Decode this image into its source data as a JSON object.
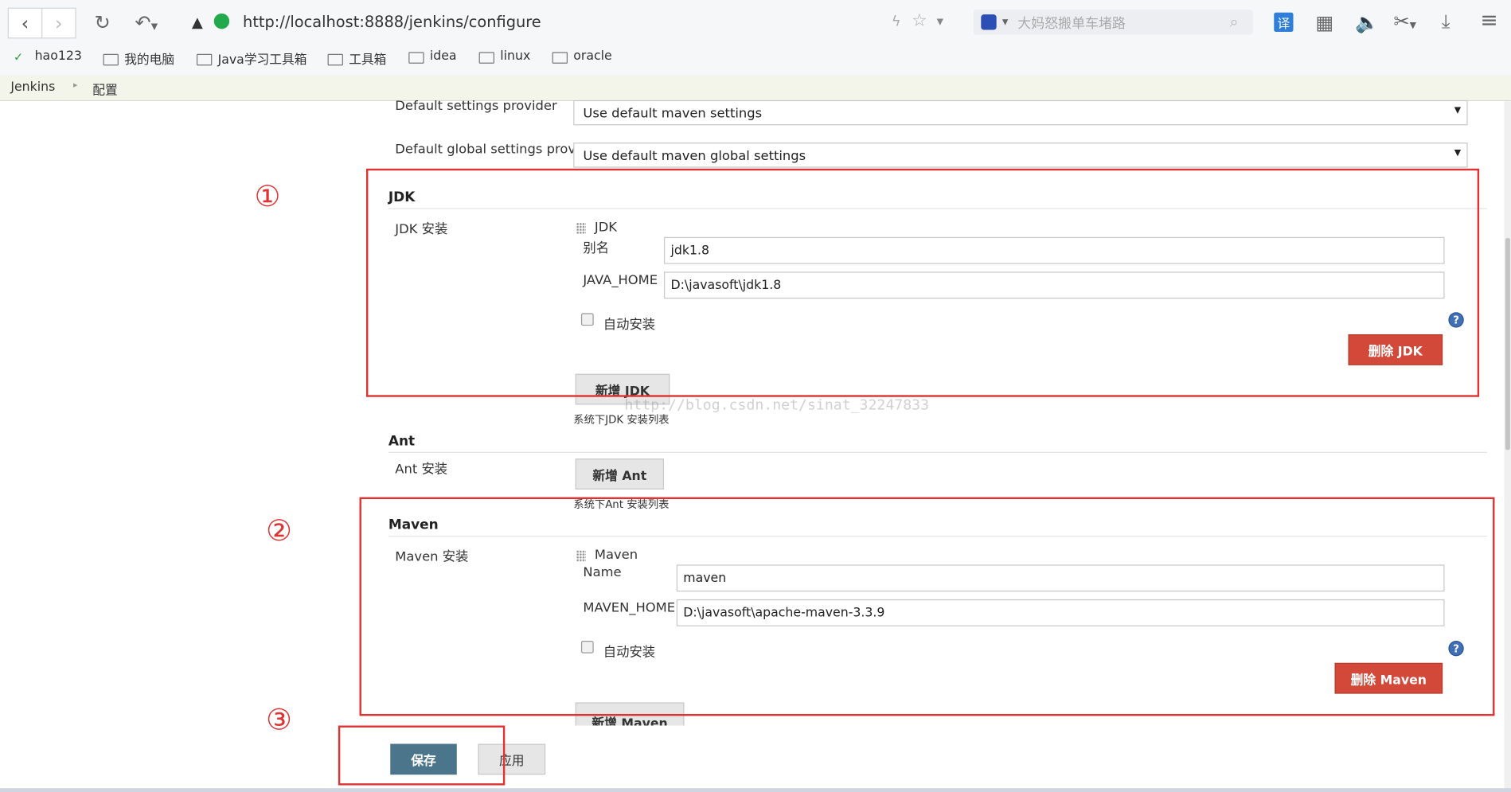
{
  "browser": {
    "url": "http://localhost:8888/jenkins/configure",
    "search_placeholder": "大妈怒搬单车堵路",
    "translate_label": "译",
    "bookmarks": [
      {
        "label": "hao123",
        "icon": "hao123-logo-icon"
      },
      {
        "label": "我的电脑",
        "icon": "folder-icon"
      },
      {
        "label": "Java学习工具箱",
        "icon": "folder-icon"
      },
      {
        "label": "工具箱",
        "icon": "folder-icon"
      },
      {
        "label": "idea",
        "icon": "folder-icon"
      },
      {
        "label": "linux",
        "icon": "folder-icon"
      },
      {
        "label": "oracle",
        "icon": "folder-icon"
      }
    ]
  },
  "breadcrumb": {
    "root": "Jenkins",
    "current": "配置"
  },
  "settings": {
    "default_settings_label": "Default settings provider",
    "default_settings_value": "Use default maven settings",
    "global_settings_label": "Default global settings provider",
    "global_settings_value": "Use default maven global settings"
  },
  "jdk": {
    "section_title": "JDK",
    "install_label": "JDK 安装",
    "item_title": "JDK",
    "alias_label": "别名",
    "alias_value": "jdk1.8",
    "home_label": "JAVA_HOME",
    "home_value": "D:\\javasoft\\jdk1.8",
    "auto_install_label": "自动安装",
    "delete_button": "删除 JDK",
    "add_button": "新增 JDK",
    "hint": "系统下JDK 安装列表"
  },
  "ant": {
    "section_title": "Ant",
    "install_label": "Ant 安装",
    "add_button": "新增 Ant",
    "hint": "系统下Ant 安装列表"
  },
  "maven": {
    "section_title": "Maven",
    "install_label": "Maven 安装",
    "item_title": "Maven",
    "name_label": "Name",
    "name_value": "maven",
    "home_label": "MAVEN_HOME",
    "home_value": "D:\\javasoft\\apache-maven-3.3.9",
    "auto_install_label": "自动安装",
    "delete_button": "删除 Maven",
    "add_button": "新增 Maven"
  },
  "actions": {
    "save": "保存",
    "apply": "应用"
  },
  "annotations": {
    "marker1": "①",
    "marker2": "②",
    "marker3": "③"
  },
  "watermark": "http://blog.csdn.net/sinat_32247833",
  "colors": {
    "annotation_red": "#dd3333",
    "delete_button": "#d24939",
    "save_button": "#4b758b",
    "help_icon": "#3f6fb4"
  }
}
